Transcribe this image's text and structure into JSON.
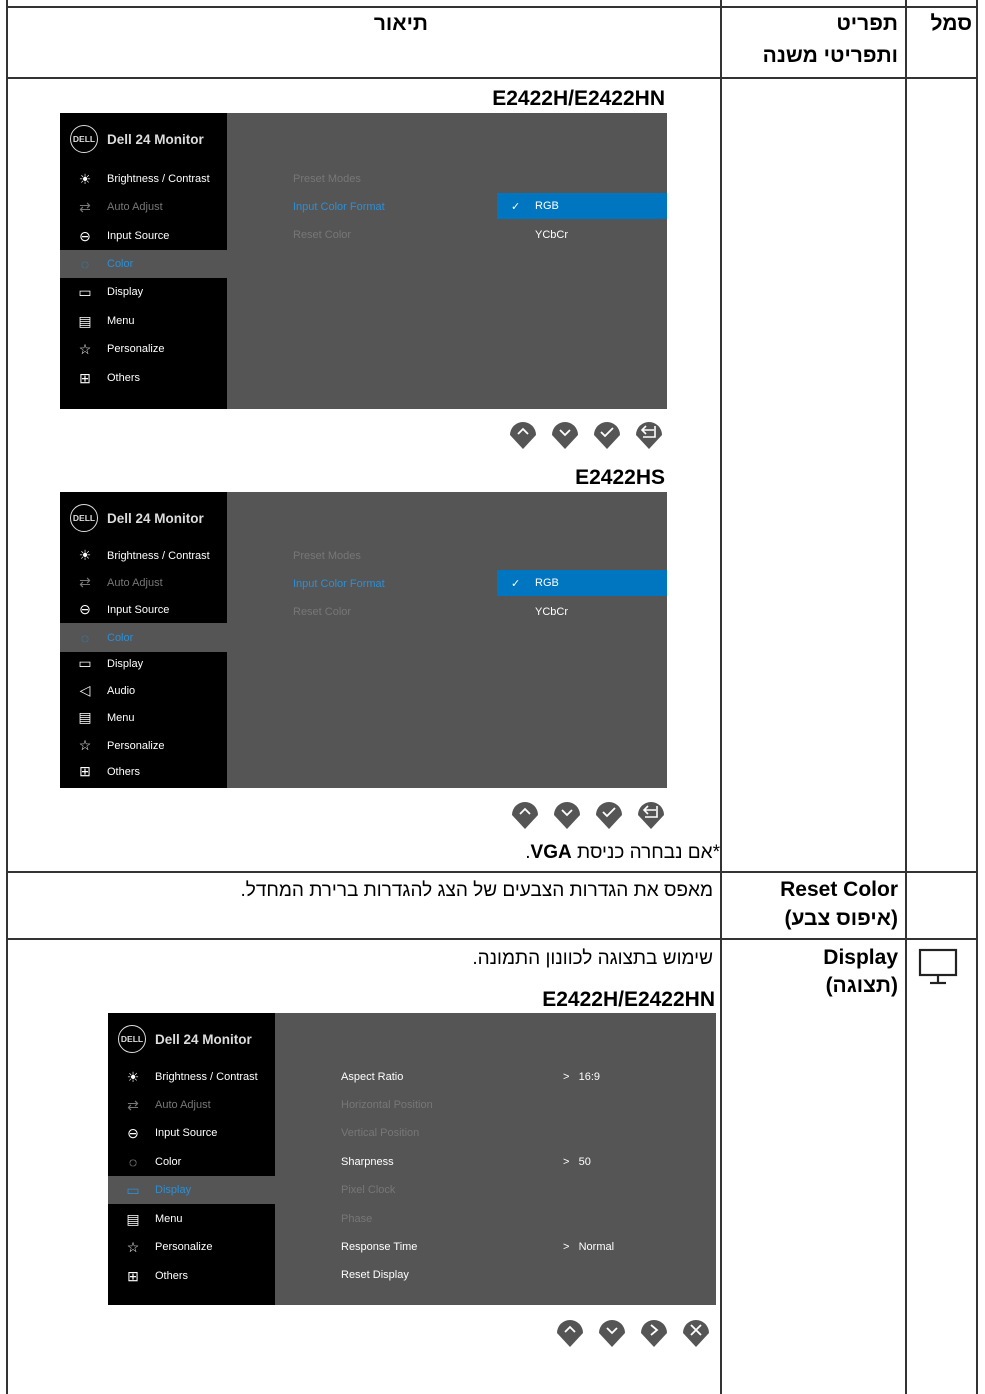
{
  "table": {
    "headers": {
      "symbol": "סמל",
      "item_line1": "תפריט",
      "item_line2": "ותפריטי משנה",
      "description": "תיאור"
    }
  },
  "row1": {
    "model_a": "E2422H/E2422HN",
    "model_b": "E2422HS",
    "footnote_prefix": "*אם נבחרה כניסת ",
    "footnote_bold": "VGA",
    "footnote_suffix": "."
  },
  "osd_a": {
    "brand_logo": "DELL",
    "title": "Dell 24 Monitor",
    "menu": [
      {
        "icon": "brightness-icon",
        "label": "Brightness / Contrast"
      },
      {
        "icon": "auto-adjust-icon",
        "label": "Auto Adjust"
      },
      {
        "icon": "input-source-icon",
        "label": "Input Source"
      },
      {
        "icon": "color-icon",
        "label": "Color"
      },
      {
        "icon": "display-icon",
        "label": "Display"
      },
      {
        "icon": "menu-icon",
        "label": "Menu"
      },
      {
        "icon": "personalize-icon",
        "label": "Personalize"
      },
      {
        "icon": "others-icon",
        "label": "Others"
      }
    ],
    "submenu": [
      "Preset Modes",
      "Input Color Format",
      "Reset Color"
    ],
    "options": [
      "RGB",
      "YCbCr"
    ],
    "checkmark": "✓"
  },
  "osd_b": {
    "brand_logo": "DELL",
    "title": "Dell 24 Monitor",
    "menu": [
      {
        "icon": "brightness-icon",
        "label": "Brightness / Contrast"
      },
      {
        "icon": "auto-adjust-icon",
        "label": "Auto Adjust"
      },
      {
        "icon": "input-source-icon",
        "label": "Input Source"
      },
      {
        "icon": "color-icon",
        "label": "Color"
      },
      {
        "icon": "display-icon",
        "label": "Display"
      },
      {
        "icon": "audio-icon",
        "label": "Audio"
      },
      {
        "icon": "menu-icon",
        "label": "Menu"
      },
      {
        "icon": "personalize-icon",
        "label": "Personalize"
      },
      {
        "icon": "others-icon",
        "label": "Others"
      }
    ],
    "submenu": [
      "Preset Modes",
      "Input Color Format",
      "Reset Color"
    ],
    "options": [
      "RGB",
      "YCbCr"
    ],
    "checkmark": "✓"
  },
  "row2": {
    "item_line1": "Reset Color",
    "item_line2": "(איפוס צבע)",
    "description": "מאפס את הגדרות הצבעים של הצג להגדרות ברירת המחדל."
  },
  "row3": {
    "item_line1": "Display",
    "item_line2": "(תצוגה)",
    "description": "שימוש בתצוגה לכוונון התמונה.",
    "model": "E2422H/E2422HN"
  },
  "osd_c": {
    "brand_logo": "DELL",
    "title": "Dell 24 Monitor",
    "menu": [
      {
        "icon": "brightness-icon",
        "label": "Brightness / Contrast"
      },
      {
        "icon": "auto-adjust-icon",
        "label": "Auto Adjust"
      },
      {
        "icon": "input-source-icon",
        "label": "Input Source"
      },
      {
        "icon": "color-icon",
        "label": "Color"
      },
      {
        "icon": "display-icon",
        "label": "Display"
      },
      {
        "icon": "menu-icon",
        "label": "Menu"
      },
      {
        "icon": "personalize-icon",
        "label": "Personalize"
      },
      {
        "icon": "others-icon",
        "label": "Others"
      }
    ],
    "submenu": [
      "Aspect Ratio",
      "Horizontal Position",
      "Vertical Position",
      "Sharpness",
      "Pixel Clock",
      "Phase",
      "Response Time",
      "Reset Display"
    ],
    "values": {
      "aspect": "16:9",
      "sharpness": "50",
      "response": "Normal"
    },
    "arrow": ">"
  },
  "colors": {
    "osd_panel": "#555555",
    "osd_sidebar": "#000000",
    "highlight_blue": "#0076c0",
    "text_blue": "#2b8fd6",
    "button_fill": "#555555"
  }
}
